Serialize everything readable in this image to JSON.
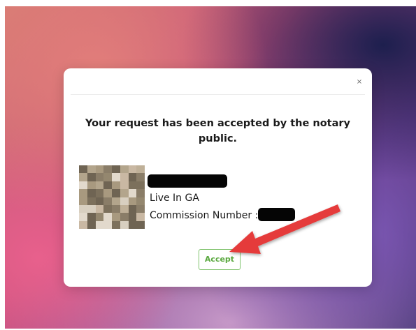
{
  "modal": {
    "close_label": "×",
    "title": "Your request has been accepted by the notary public.",
    "notary": {
      "location": "Live In GA",
      "commission_label": "Commission Number :"
    },
    "accept_label": "Accept"
  },
  "colors": {
    "accept_text": "#5aa83f",
    "accept_border": "#7ec26b",
    "annotation_arrow": "#e53b3b"
  }
}
